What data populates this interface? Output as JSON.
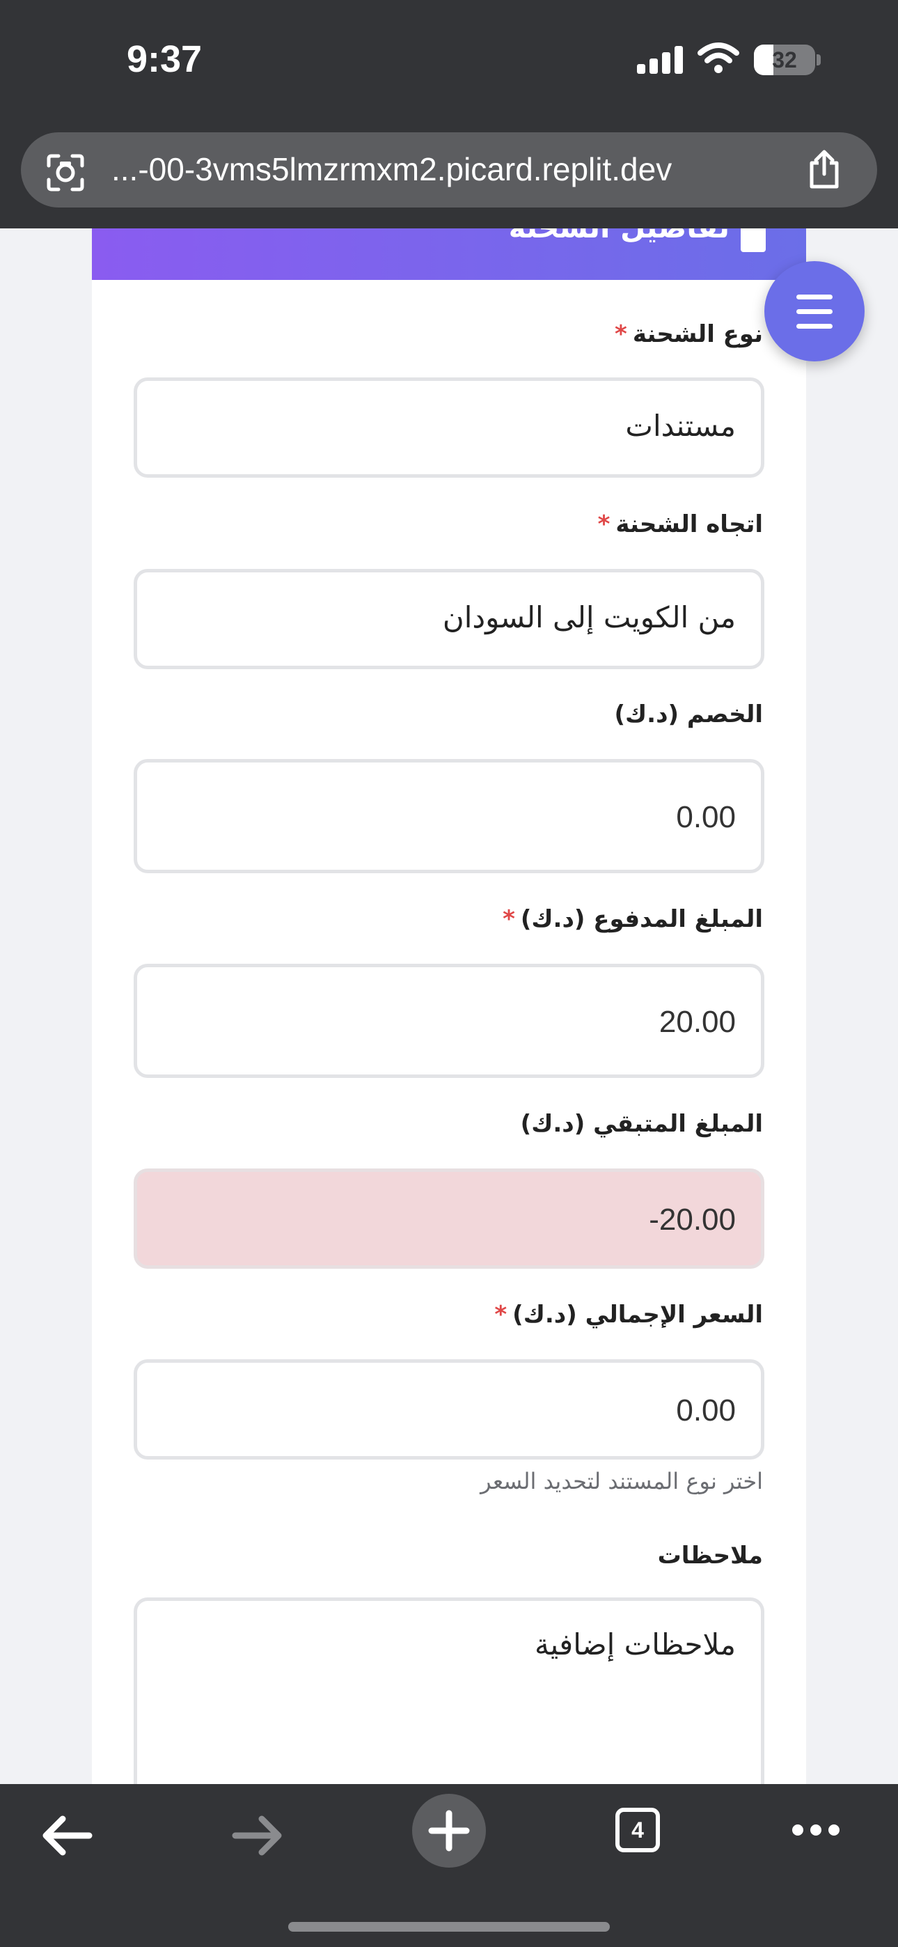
{
  "status_bar": {
    "time": "9:37",
    "battery": "32",
    "battery_level_percent": 32
  },
  "browser": {
    "url": "...-00-3vms5lmzrmxm2.picard.replit.dev",
    "tab_count": "4"
  },
  "header": {
    "title": "تفاصيل الشحنة"
  },
  "form": {
    "shipment_type": {
      "label": "نوع الشحنة",
      "required": "*",
      "value": "مستندات"
    },
    "shipment_direction": {
      "label": "اتجاه الشحنة",
      "required": "*",
      "value": "من الكويت إلى السودان"
    },
    "discount": {
      "label": "الخصم (د.ك)",
      "value": "0.00"
    },
    "paid_amount": {
      "label": "المبلغ المدفوع (د.ك)",
      "required": "*",
      "value": "20.00"
    },
    "remaining_amount": {
      "label": "المبلغ المتبقي (د.ك)",
      "value": "-20.00"
    },
    "total_price": {
      "label": "السعر الإجمالي (د.ك)",
      "required": "*",
      "value": "0.00",
      "hint": "اختر نوع المستند لتحديد السعر"
    },
    "notes": {
      "label": "ملاحظات",
      "placeholder": "ملاحظات إضافية"
    }
  },
  "colors": {
    "accent": "#6b6ee8",
    "header_gradient_start": "#8a5cf0",
    "required": "#e04848",
    "error_bg": "#f2d7da"
  },
  "icons": {
    "scan": "scan-icon",
    "share": "share-icon",
    "menu": "hamburger-icon",
    "back": "arrow-left-icon",
    "forward": "arrow-right-icon",
    "new_tab": "plus-icon",
    "more": "more-icon"
  }
}
